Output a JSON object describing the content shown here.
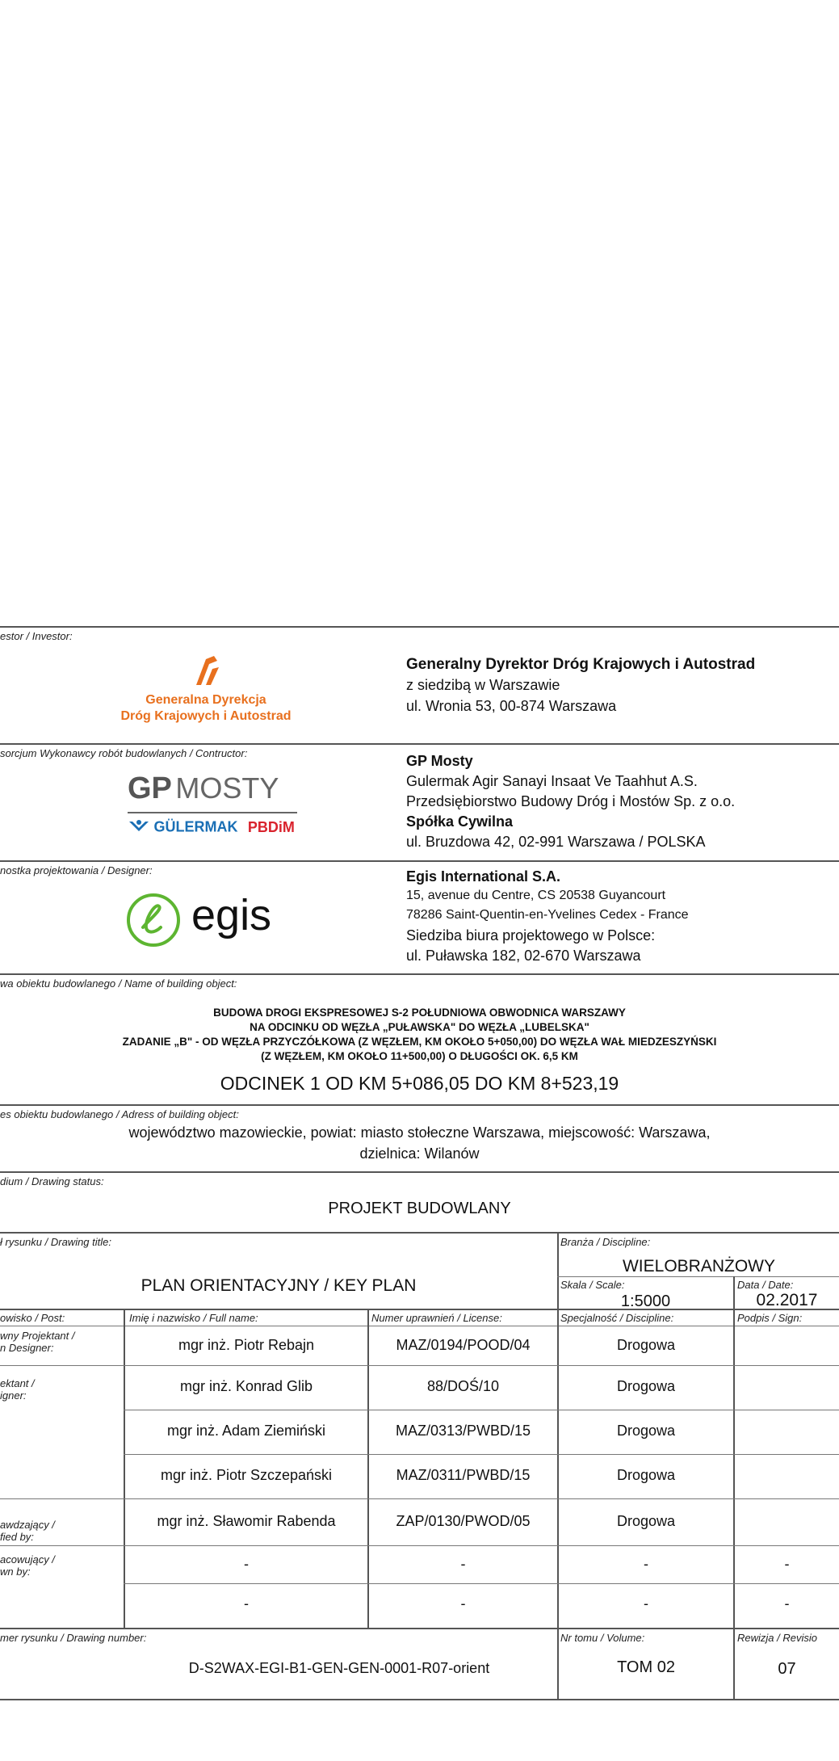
{
  "investor": {
    "label": "estor / Investor:",
    "logo_line1": "Generalna Dyrekcja",
    "logo_line2": "Dróg Krajowych i Autostrad",
    "name": "Generalny Dyrektor Dróg Krajowych i Autostrad",
    "line1": "z siedzibą w Warszawie",
    "line2": "ul. Wronia 53, 00-874 Warszawa"
  },
  "contractor": {
    "label": "sorcjum Wykonawcy robót budowlanych / Contructor:",
    "logo_gp": "GP",
    "logo_mosty": "MOSTY",
    "logo_gulermak": "GÜLERMAK",
    "logo_pbdim": "PBDiM",
    "name": "GP Mosty",
    "line1": "Gulermak Agir Sanayi Insaat Ve Taahhut A.S.",
    "line2": "Przedsiębiorstwo Budowy Dróg i Mostów Sp. z o.o.",
    "name2": "Spółka Cywilna",
    "line3": "ul. Bruzdowa 42, 02-991 Warszawa / POLSKA"
  },
  "designer": {
    "label": "nostka projektowania / Designer:",
    "logo_text": "egis",
    "name": "Egis International S.A.",
    "line1": "15, avenue du Centre, CS 20538 Guyancourt",
    "line2": "78286 Saint-Quentin-en-Yvelines Cedex - France",
    "line3": "Siedziba biura projektowego w Polsce:",
    "line4": "ul. Puławska 182, 02-670 Warszawa"
  },
  "object": {
    "label": "wa obiektu budowlanego / Name of building object:",
    "line1": "BUDOWA DROGI EKSPRESOWEJ S-2 POŁUDNIOWA OBWODNICA WARSZAWY",
    "line2": "NA ODCINKU OD WĘZŁA „PUŁAWSKA\" DO WĘZŁA „LUBELSKA\"",
    "line3": "ZADANIE „B\" - OD WĘZŁA PRZYCZÓŁKOWA (Z WĘZŁEM, KM OKOŁO 5+050,00) DO WĘZŁA WAŁ MIEDZESZYŃSKI",
    "line4": "(Z WĘZŁEM, KM OKOŁO 11+500,00) O DŁUGOŚCI OK. 6,5 KM",
    "section": "ODCINEK 1 OD KM 5+086,05 DO KM 8+523,19"
  },
  "address": {
    "label": "es obiektu budowlanego / Adress of building object:",
    "line1": "województwo mazowieckie, powiat: miasto stołeczne Warszawa, miejscowość: Warszawa,",
    "line2": "dzielnica: Wilanów"
  },
  "status": {
    "label": "dium / Drawing status:",
    "value": "PROJEKT BUDOWLANY"
  },
  "title": {
    "label": "ł rysunku / Drawing title:",
    "value": "PLAN ORIENTACYJNY / KEY PLAN",
    "branch_label": "Branża / Discipline:",
    "branch_value": "WIELOBRANŻOWY",
    "scale_label": "Skala / Scale:",
    "scale_value": "1:5000",
    "date_label": "Data / Date:",
    "date_value": "02.2017"
  },
  "table": {
    "headers": [
      "owisko / Post:",
      "Imię i nazwisko / Full name:",
      "Numer uprawnień / License:",
      "Specjalność / Discipline:",
      "Podpis / Sign:"
    ],
    "roles": {
      "chief": "wny Projektant /",
      "chief2": "n Designer:",
      "designer": "ektant /",
      "designer2": "igner:",
      "verified": "awdzający /",
      "verified2": "fied by:",
      "drawn": "acowujący /",
      "drawn2": "wn by:"
    },
    "rows": [
      {
        "name": "mgr inż. Piotr Rebajn",
        "license": "MAZ/0194/POOD/04",
        "discipline": "Drogowa",
        "sign": ""
      },
      {
        "name": "mgr inż. Konrad Glib",
        "license": "88/DOŚ/10",
        "discipline": "Drogowa",
        "sign": ""
      },
      {
        "name": "mgr inż. Adam Ziemiński",
        "license": "MAZ/0313/PWBD/15",
        "discipline": "Drogowa",
        "sign": ""
      },
      {
        "name": "mgr inż. Piotr Szczepański",
        "license": "MAZ/0311/PWBD/15",
        "discipline": "Drogowa",
        "sign": ""
      },
      {
        "name": "mgr inż. Sławomir Rabenda",
        "license": "ZAP/0130/PWOD/05",
        "discipline": "Drogowa",
        "sign": ""
      },
      {
        "name": "-",
        "license": "-",
        "discipline": "-",
        "sign": "-"
      },
      {
        "name": "-",
        "license": "-",
        "discipline": "-",
        "sign": "-"
      }
    ]
  },
  "footer": {
    "number_label": "mer rysunku / Drawing number:",
    "number_value": "D-S2WAX-EGI-B1-GEN-GEN-0001-R07-orient",
    "volume_label": "Nr tomu / Volume:",
    "volume_value": "TOM 02",
    "revision_label": "Rewizja / Revisio",
    "revision_value": "07"
  },
  "colors": {
    "gddkia_orange": "#e8701e",
    "egis_green": "#5db531",
    "gulermak_blue": "#1a6fb5",
    "pbdim_red": "#d9232d"
  }
}
